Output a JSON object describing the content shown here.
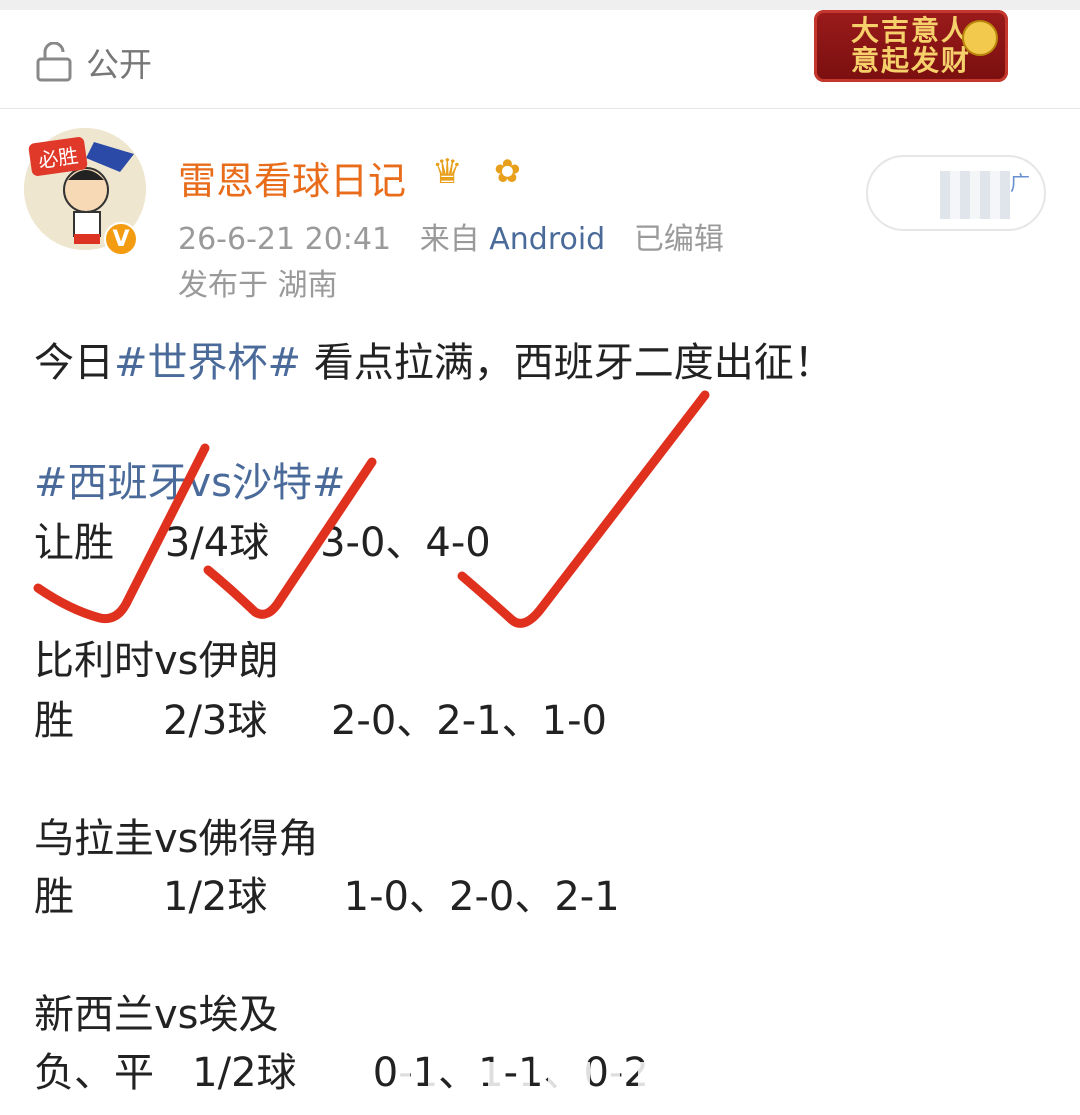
{
  "header": {
    "visibility_label": "公开",
    "banner_text_line1": "大吉意人",
    "banner_text_line2": "意起发财"
  },
  "post": {
    "username": "雷恩看球日记",
    "timestamp": "26-6-21 20:41",
    "source_prefix": "来自",
    "source_os": "Android",
    "edited": "已编辑",
    "location": "发布于 湖南",
    "follow_ad": "广",
    "avatar_tag": "必胜"
  },
  "content": {
    "intro_before": "今日",
    "intro_tag": "#世界杯#",
    "intro_after": " 看点拉满，西班牙二度出征！",
    "match1_title": "#西班牙vs沙特#",
    "match1_line": "让胜    3/4球    3-0、4-0",
    "match2_title": "比利时vs伊朗",
    "match2_line": "胜       2/3球     2-0、2-1、1-0",
    "match3_title": "乌拉圭vs佛得角",
    "match3_line": "胜       1/2球      1-0、2-0、2-1",
    "match4_title": "新西兰vs埃及",
    "match4_line": "负、平   1/2球      0-1、1-1、0-2"
  },
  "colors": {
    "username": "#e86c1a",
    "link": "#4a6b9a",
    "check_marks": "#e0301e"
  }
}
